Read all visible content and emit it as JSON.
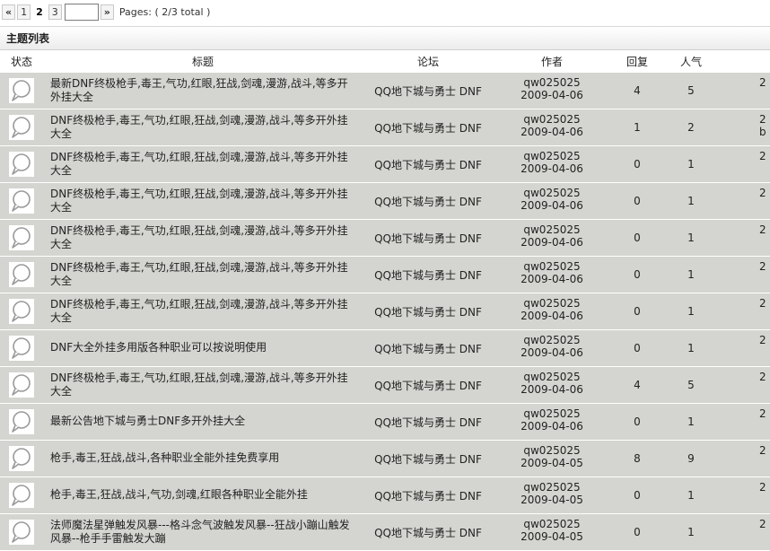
{
  "pager": {
    "first_arrow": "«",
    "pages": [
      "1",
      "2",
      "3"
    ],
    "current_page": "2",
    "next_arrow": "»",
    "input_value": "",
    "info": "Pages: ( 2/3 total )"
  },
  "panel_title": "主题列表",
  "columns": {
    "status": "状态",
    "title": "标题",
    "forum": "论坛",
    "author": "作者",
    "replies": "回复",
    "views": "人气"
  },
  "rows": [
    {
      "title": "最新DNF终极枪手,毒王,气功,红眼,狂战,剑魂,漫游,战斗,等多开外挂大全",
      "forum": "QQ地下城与勇士 DNF",
      "author": "qw025025",
      "date": "2009-04-06",
      "replies": "4",
      "views": "5",
      "last1": "2",
      "last2": ""
    },
    {
      "title": "DNF终极枪手,毒王,气功,红眼,狂战,剑魂,漫游,战斗,等多开外挂大全",
      "forum": "QQ地下城与勇士 DNF",
      "author": "qw025025",
      "date": "2009-04-06",
      "replies": "1",
      "views": "2",
      "last1": "2",
      "last2": "b"
    },
    {
      "title": "DNF终极枪手,毒王,气功,红眼,狂战,剑魂,漫游,战斗,等多开外挂大全",
      "forum": "QQ地下城与勇士 DNF",
      "author": "qw025025",
      "date": "2009-04-06",
      "replies": "0",
      "views": "1",
      "last1": "2",
      "last2": ""
    },
    {
      "title": "DNF终极枪手,毒王,气功,红眼,狂战,剑魂,漫游,战斗,等多开外挂大全",
      "forum": "QQ地下城与勇士 DNF",
      "author": "qw025025",
      "date": "2009-04-06",
      "replies": "0",
      "views": "1",
      "last1": "2",
      "last2": ""
    },
    {
      "title": "DNF终极枪手,毒王,气功,红眼,狂战,剑魂,漫游,战斗,等多开外挂大全",
      "forum": "QQ地下城与勇士 DNF",
      "author": "qw025025",
      "date": "2009-04-06",
      "replies": "0",
      "views": "1",
      "last1": "2",
      "last2": ""
    },
    {
      "title": "DNF终极枪手,毒王,气功,红眼,狂战,剑魂,漫游,战斗,等多开外挂大全",
      "forum": "QQ地下城与勇士 DNF",
      "author": "qw025025",
      "date": "2009-04-06",
      "replies": "0",
      "views": "1",
      "last1": "2",
      "last2": ""
    },
    {
      "title": "DNF终极枪手,毒王,气功,红眼,狂战,剑魂,漫游,战斗,等多开外挂大全",
      "forum": "QQ地下城与勇士 DNF",
      "author": "qw025025",
      "date": "2009-04-06",
      "replies": "0",
      "views": "1",
      "last1": "2",
      "last2": ""
    },
    {
      "title": "DNF大全外挂多用版各种职业可以按说明使用",
      "forum": "QQ地下城与勇士 DNF",
      "author": "qw025025",
      "date": "2009-04-06",
      "replies": "0",
      "views": "1",
      "last1": "2",
      "last2": ""
    },
    {
      "title": "DNF终极枪手,毒王,气功,红眼,狂战,剑魂,漫游,战斗,等多开外挂大全",
      "forum": "QQ地下城与勇士 DNF",
      "author": "qw025025",
      "date": "2009-04-06",
      "replies": "4",
      "views": "5",
      "last1": "2",
      "last2": ""
    },
    {
      "title": "最新公告地下城与勇士DNF多开外挂大全",
      "forum": "QQ地下城与勇士 DNF",
      "author": "qw025025",
      "date": "2009-04-06",
      "replies": "0",
      "views": "1",
      "last1": "2",
      "last2": ""
    },
    {
      "title": "枪手,毒王,狂战,战斗,各种职业全能外挂免费享用",
      "forum": "QQ地下城与勇士 DNF",
      "author": "qw025025",
      "date": "2009-04-05",
      "replies": "8",
      "views": "9",
      "last1": "2",
      "last2": ""
    },
    {
      "title": "枪手,毒王,狂战,战斗,气功,剑魂,红眼各种职业全能外挂",
      "forum": "QQ地下城与勇士 DNF",
      "author": "qw025025",
      "date": "2009-04-05",
      "replies": "0",
      "views": "1",
      "last1": "2",
      "last2": ""
    },
    {
      "title": "法师魔法星弹触发风暴---格斗念气波触发风暴--狂战小蹦山触发风暴--枪手手雷触发大蹦",
      "forum": "QQ地下城与勇士 DNF",
      "author": "qw025025",
      "date": "2009-04-05",
      "replies": "0",
      "views": "1",
      "last1": "2",
      "last2": ""
    }
  ]
}
